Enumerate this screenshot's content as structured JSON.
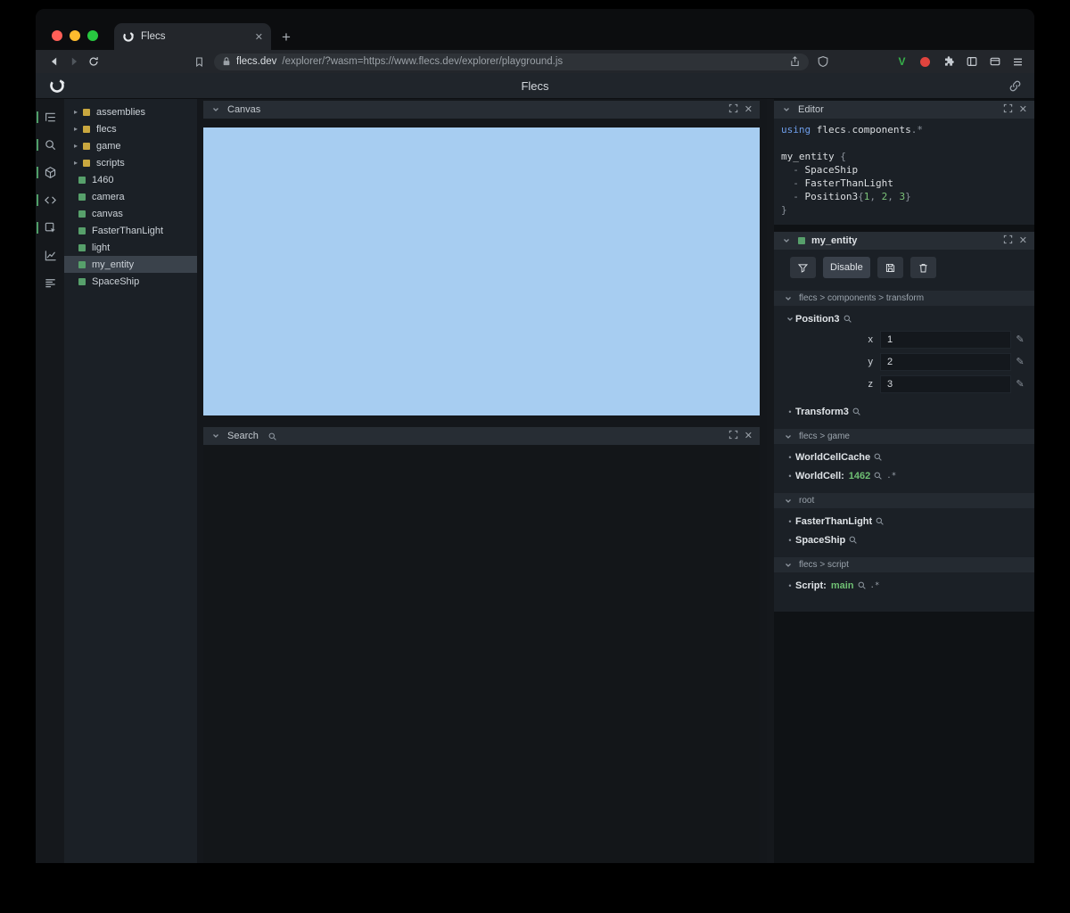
{
  "colors": {
    "canvas_blue": "#a7cdf1",
    "entity_green": "#57a06b",
    "module_yellow": "#c9a73f",
    "value_green": "#6fbf73",
    "keyword_blue": "#6e9eea"
  },
  "browser": {
    "tab": {
      "title": "Flecs"
    },
    "address": {
      "host": "flecs.dev",
      "path": "/explorer/?wasm=https://www.flecs.dev/explorer/playground.js"
    },
    "vpn_label": "V"
  },
  "app_header": {
    "title": "Flecs"
  },
  "rail": {
    "icons": [
      {
        "name": "tree-icon",
        "active": true
      },
      {
        "name": "search-icon",
        "active": true
      },
      {
        "name": "canvas-icon",
        "active": true
      },
      {
        "name": "editor-icon",
        "active": true
      },
      {
        "name": "inspector-icon",
        "active": true
      },
      {
        "name": "chart-icon",
        "active": false
      },
      {
        "name": "stats-icon",
        "active": false
      }
    ]
  },
  "tree": {
    "items": [
      {
        "label": "assemblies",
        "kind": "module",
        "expandable": true
      },
      {
        "label": "flecs",
        "kind": "module",
        "expandable": true
      },
      {
        "label": "game",
        "kind": "module",
        "expandable": true
      },
      {
        "label": "scripts",
        "kind": "module",
        "expandable": true
      },
      {
        "label": "1460",
        "kind": "entity",
        "expandable": false
      },
      {
        "label": "camera",
        "kind": "entity",
        "expandable": false
      },
      {
        "label": "canvas",
        "kind": "entity",
        "expandable": false
      },
      {
        "label": "FasterThanLight",
        "kind": "entity",
        "expandable": false
      },
      {
        "label": "light",
        "kind": "entity",
        "expandable": false
      },
      {
        "label": "my_entity",
        "kind": "entity",
        "expandable": false,
        "selected": true
      },
      {
        "label": "SpaceShip",
        "kind": "entity",
        "expandable": false
      }
    ]
  },
  "canvas_panel": {
    "title": "Canvas"
  },
  "search_panel": {
    "title": "Search"
  },
  "editor_panel": {
    "title": "Editor",
    "code": [
      [
        {
          "t": "kw",
          "s": "using"
        },
        {
          "t": "id",
          "s": " flecs"
        },
        {
          "t": "p",
          "s": "."
        },
        {
          "t": "id",
          "s": "components"
        },
        {
          "t": "p",
          "s": "."
        },
        {
          "t": "op",
          "s": "*"
        }
      ],
      [],
      [
        {
          "t": "id",
          "s": "my_entity"
        },
        {
          "t": "p",
          "s": " {"
        }
      ],
      [
        {
          "t": "p",
          "s": "  - "
        },
        {
          "t": "id",
          "s": "SpaceShip"
        }
      ],
      [
        {
          "t": "p",
          "s": "  - "
        },
        {
          "t": "id",
          "s": "FasterThanLight"
        }
      ],
      [
        {
          "t": "p",
          "s": "  - "
        },
        {
          "t": "id",
          "s": "Position3"
        },
        {
          "t": "p",
          "s": "{"
        },
        {
          "t": "num",
          "s": "1"
        },
        {
          "t": "p",
          "s": ", "
        },
        {
          "t": "num",
          "s": "2"
        },
        {
          "t": "p",
          "s": ", "
        },
        {
          "t": "num",
          "s": "3"
        },
        {
          "t": "p",
          "s": "}"
        }
      ],
      [
        {
          "t": "p",
          "s": "}"
        }
      ]
    ]
  },
  "inspector": {
    "title": "my_entity",
    "toolbar": {
      "disable_label": "Disable"
    },
    "sections": [
      {
        "path": "flecs > components > transform",
        "items": [
          {
            "name": "Position3",
            "expanded": true,
            "fields": [
              {
                "key": "x",
                "value": "1"
              },
              {
                "key": "y",
                "value": "2"
              },
              {
                "key": "z",
                "value": "3"
              }
            ]
          },
          {
            "name": "Transform3"
          }
        ]
      },
      {
        "path": "flecs > game",
        "items": [
          {
            "name": "WorldCellCache"
          },
          {
            "name": "WorldCell:",
            "value": "1462",
            "ref": true
          }
        ]
      },
      {
        "path": "root",
        "items": [
          {
            "name": "FasterThanLight"
          },
          {
            "name": "SpaceShip"
          }
        ]
      },
      {
        "path": "flecs > script",
        "items": [
          {
            "name": "Script:",
            "value": "main",
            "ref": true
          }
        ]
      }
    ]
  }
}
